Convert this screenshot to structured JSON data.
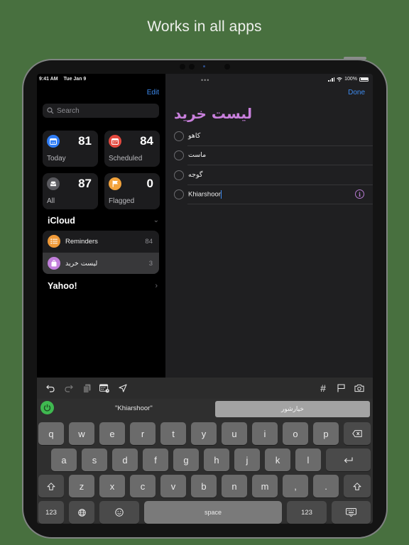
{
  "headline": "Works in all apps",
  "status_bar": {
    "time": "9:41 AM",
    "date": "Tue Jan 9",
    "battery_text": "100%",
    "battery_level": 1.0
  },
  "sidebar": {
    "edit_label": "Edit",
    "search_placeholder": "Search",
    "smart_lists": [
      {
        "name": "Today",
        "count": "81",
        "icon": "calendar-today-icon",
        "color": "#2f7df6"
      },
      {
        "name": "Scheduled",
        "count": "84",
        "icon": "calendar-icon",
        "color": "#e5493f"
      },
      {
        "name": "All",
        "count": "87",
        "icon": "tray-icon",
        "color": "#5b5b60"
      },
      {
        "name": "Flagged",
        "count": "0",
        "icon": "flag-icon",
        "color": "#f2a33c"
      }
    ],
    "accounts": [
      {
        "name": "iCloud",
        "expanded": true,
        "lists": [
          {
            "name": "Reminders",
            "count": "84",
            "icon": "list-bullet-icon",
            "color": "#f09a38",
            "selected": false
          },
          {
            "name": "لیست خرید",
            "count": "3",
            "icon": "shopping-bag-icon",
            "color": "#c27fdc",
            "selected": true
          }
        ]
      },
      {
        "name": "Yahoo!",
        "expanded": false,
        "lists": []
      }
    ]
  },
  "detail": {
    "done_label": "Done",
    "title": "لیست خرید",
    "title_color": "#c980dd",
    "items": [
      {
        "text": "کاهو",
        "editing": false
      },
      {
        "text": "ماست",
        "editing": false
      },
      {
        "text": "گوجه",
        "editing": false
      },
      {
        "text": "Khiarshoor",
        "editing": true
      }
    ]
  },
  "keyboard": {
    "toolbar": {
      "left": [
        "undo-icon",
        "redo-icon",
        "copy-icon",
        "date-icon",
        "location-icon"
      ],
      "right": [
        "hashtag-icon",
        "flag-icon",
        "camera-icon"
      ],
      "hashtag_glyph": "#"
    },
    "suggestion_literal": "\"Khiarshoor\"",
    "suggestion_translit": "خیارشور",
    "rows": [
      [
        "q",
        "w",
        "e",
        "r",
        "t",
        "y",
        "u",
        "i",
        "o",
        "p"
      ],
      [
        "a",
        "s",
        "d",
        "f",
        "g",
        "h",
        "j",
        "k",
        "l"
      ],
      [
        "z",
        "x",
        "c",
        "v",
        "b",
        "n",
        "m",
        ",",
        "."
      ]
    ],
    "numbers_label": "123",
    "space_label": "space"
  }
}
